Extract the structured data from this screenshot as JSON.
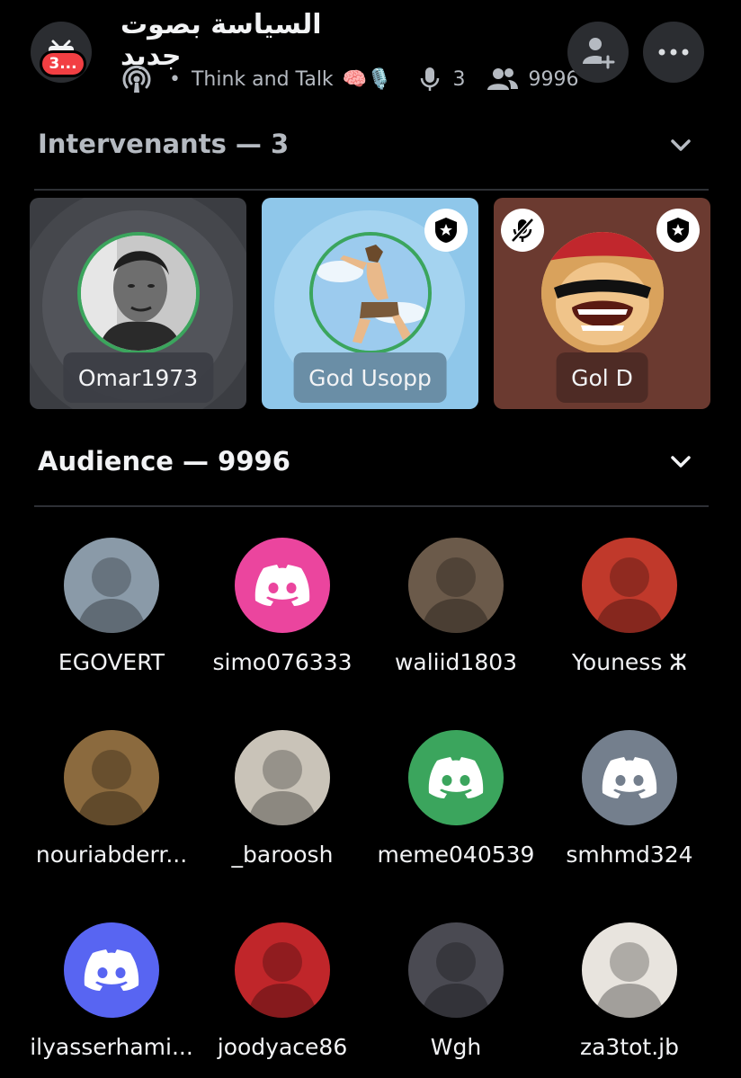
{
  "header": {
    "badge": "3...",
    "title": "السياسة بصوت جديد",
    "topic": "Think and Talk",
    "topic_emoji": "🧠🎙️",
    "speakers_count": "3",
    "listeners_count": "9996"
  },
  "speakers_section": {
    "label": "Intervenants — 3"
  },
  "speakers": [
    {
      "name": "Omar1973",
      "speaking": true,
      "moderator": false,
      "muted": false
    },
    {
      "name": "God Usopp",
      "speaking": true,
      "moderator": true,
      "muted": false
    },
    {
      "name": "Gol D",
      "speaking": false,
      "moderator": true,
      "muted": true
    }
  ],
  "audience_section": {
    "label": "Audience — 9996"
  },
  "audience": [
    {
      "name": "EGOVERT",
      "avatar": "photo",
      "color": "#8a9aa8"
    },
    {
      "name": "simo076333",
      "avatar": "discord-logo",
      "color": "#eb459e"
    },
    {
      "name": "waliid1803",
      "avatar": "photo",
      "color": "#6b5a4a"
    },
    {
      "name": "Youness ⵣ",
      "avatar": "photo",
      "color": "#c0392b"
    },
    {
      "name": "nouriabderr...",
      "avatar": "photo",
      "color": "#8b6a3e"
    },
    {
      "name": "_baroosh",
      "avatar": "photo",
      "color": "#c9c3b8"
    },
    {
      "name": "meme040539",
      "avatar": "discord-logo",
      "color": "#3ba55d"
    },
    {
      "name": "smhmd324",
      "avatar": "discord-logo",
      "color": "#747f8d"
    },
    {
      "name": "ilyasserhami...",
      "avatar": "discord-logo",
      "color": "#5865f2"
    },
    {
      "name": "joodyace86",
      "avatar": "photo",
      "color": "#c0262a"
    },
    {
      "name": "Wgh",
      "avatar": "photo",
      "color": "#4a4a52"
    },
    {
      "name": "za3tot.jb",
      "avatar": "photo",
      "color": "#e8e4de"
    }
  ]
}
